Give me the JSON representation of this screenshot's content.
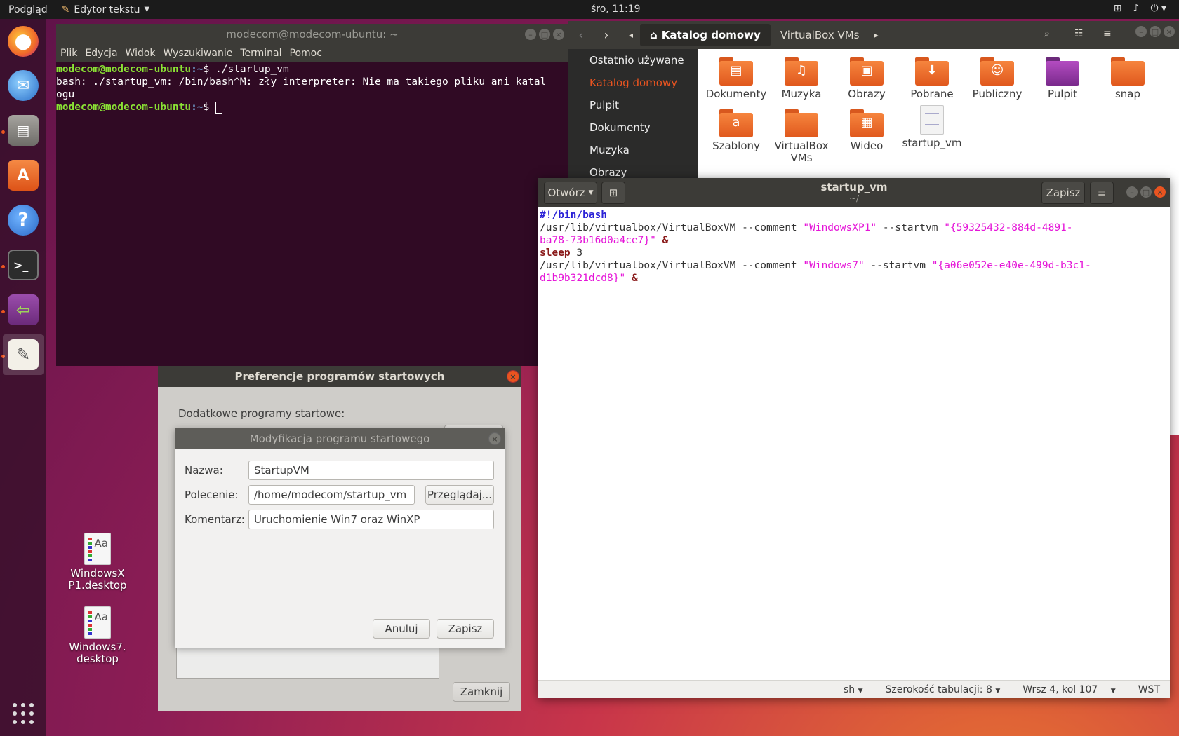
{
  "topbar": {
    "activities": "Podgląd",
    "app_name": "Edytor tekstu",
    "clock": "śro, 11:19"
  },
  "dock": {
    "items": [
      "firefox-icon",
      "thunderbird-icon",
      "files-icon",
      "software-icon",
      "help-icon",
      "terminal-icon",
      "startup-apps-icon",
      "text-editor-icon",
      "app-grid-icon"
    ]
  },
  "terminal": {
    "title": "modecom@modecom-ubuntu: ~",
    "menu": [
      "Plik",
      "Edycja",
      "Widok",
      "Wyszukiwanie",
      "Terminal",
      "Pomoc"
    ],
    "prompt_user": "modecom@modecom-ubuntu",
    "prompt_path": ":~",
    "command": "$ ./startup_vm",
    "output_line1": "bash: ./startup_vm: /bin/bash^M: zły interpreter: Nie ma takiego pliku ani katal",
    "output_line2": "ogu",
    "prompt_end": "$ "
  },
  "files": {
    "path_current": "Katalog domowy",
    "path_next": "VirtualBox VMs",
    "sidebar": [
      "Ostatnio używane",
      "Katalog domowy",
      "Pulpit",
      "Dokumenty",
      "Muzyka",
      "Obrazy"
    ],
    "items": [
      {
        "label": "Dokumenty",
        "glyph": "▤"
      },
      {
        "label": "Muzyka",
        "glyph": "♫"
      },
      {
        "label": "Obrazy",
        "glyph": "▣"
      },
      {
        "label": "Pobrane",
        "glyph": "⬇"
      },
      {
        "label": "Publiczny",
        "glyph": "☺"
      },
      {
        "label": "Pulpit",
        "glyph": ""
      },
      {
        "label": "snap",
        "glyph": ""
      },
      {
        "label": "Szablony",
        "glyph": "a"
      },
      {
        "label": "VirtualBox VMs",
        "glyph": ""
      },
      {
        "label": "Wideo",
        "glyph": "▦"
      },
      {
        "label": "startup_vm",
        "glyph": ""
      }
    ]
  },
  "gedit": {
    "open_label": "Otwórz",
    "title": "startup_vm",
    "subtitle": "~/",
    "save_label": "Zapisz",
    "code": {
      "l1": "#!/bin/bash",
      "l2a": "/usr/lib/virtualbox/VirtualBoxVM --comment ",
      "l2b": "\"WindowsXP1\"",
      "l2c": " --startvm ",
      "l2d": "\"{59325432-884d-4891-",
      "l3a": "ba78-73b16d0a4ce7}\"",
      "l3b": " &",
      "l4a": "sleep",
      "l4b": " 3",
      "l5a": "/usr/lib/virtualbox/VirtualBoxVM --comment ",
      "l5b": "\"Windows7\"",
      "l5c": " --startvm ",
      "l5d": "\"{a06e052e-e40e-499d-b3c1-",
      "l6a": "d1b9b321dcd8}\"",
      "l6b": " &"
    },
    "status": {
      "lang": "sh",
      "tab_width": "Szerokość tabulacji: 8",
      "position": "Wrsz 4, kol 107",
      "mode": "WST"
    }
  },
  "prefs": {
    "title": "Preferencje programów startowych",
    "label": "Dodatkowe programy startowe:",
    "close_label": "Zamknij"
  },
  "modify": {
    "title": "Modyfikacja programu startowego",
    "name_label": "Nazwa:",
    "name_value": "StartupVM",
    "command_label": "Polecenie:",
    "command_value": "/home/modecom/startup_vm",
    "browse_label": "Przeglądaj...",
    "comment_label": "Komentarz:",
    "comment_value": "Uruchomienie Win7 oraz WinXP",
    "cancel_label": "Anuluj",
    "save_label": "Zapisz"
  },
  "desktop": {
    "icon1_line1": "WindowsX",
    "icon1_line2": "P1.desktop",
    "icon2_line1": "Windows7.",
    "icon2_line2": "desktop"
  }
}
